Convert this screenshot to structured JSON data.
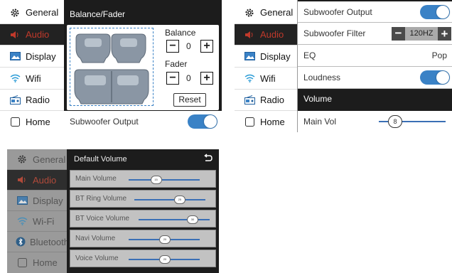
{
  "panel1": {
    "sidebar": [
      "General",
      "Audio",
      "Display",
      "Wifi",
      "Radio",
      "Home"
    ],
    "title": "Balance/Fader",
    "balance_label": "Balance",
    "balance_value": "0",
    "fader_label": "Fader",
    "fader_value": "0",
    "reset_label": "Reset",
    "subwoofer_label": "Subwoofer Output"
  },
  "panel2": {
    "sidebar": [
      "General",
      "Audio",
      "Display",
      "Wifi",
      "Radio",
      "Home"
    ],
    "subwoofer_output": "Subwoofer Output",
    "subwoofer_filter": "Subwoofer Filter",
    "filter_value": "120HZ",
    "eq_label": "EQ",
    "eq_value": "Pop",
    "loudness_label": "Loudness",
    "volume_header": "Volume",
    "main_vol_label": "Main Vol",
    "main_vol_value": "8"
  },
  "panel3": {
    "sidebar": [
      "General",
      "Audio",
      "Display",
      "Wi-Fi",
      "Bluetooth",
      "Home"
    ],
    "title": "Default Volume",
    "rows": [
      {
        "label": "Main Volume",
        "value": "15"
      },
      {
        "label": "BT Ring Volume",
        "value": "25"
      },
      {
        "label": "BT Voice Volume",
        "value": "30"
      },
      {
        "label": "Navi Volume",
        "value": "20"
      },
      {
        "label": "Voice Volume",
        "value": "20"
      }
    ]
  },
  "colors": {
    "accent": "#3a82c6",
    "active_text": "#c0392b",
    "dark": "#1c1c1c"
  },
  "icons": [
    "gear-icon",
    "speaker-icon",
    "display-icon",
    "wifi-icon",
    "radio-icon",
    "home-checkbox-icon",
    "bluetooth-icon",
    "back-arrow-icon"
  ]
}
